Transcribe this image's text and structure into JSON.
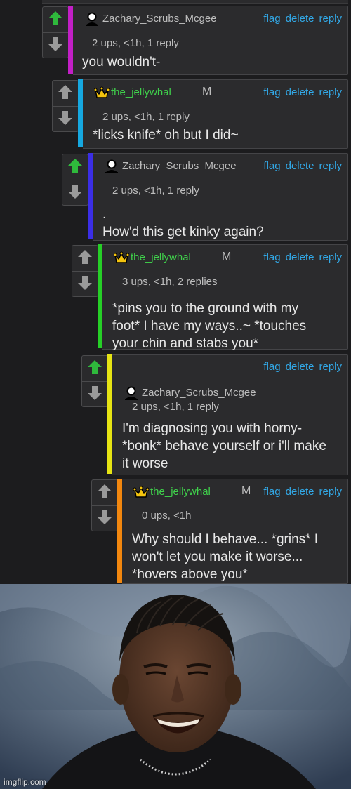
{
  "actions": {
    "flag": "flag",
    "delete": "delete",
    "reply": "reply"
  },
  "comments": [
    {
      "username": "Zachary_Scrubs_Mcgee",
      "mod_badge": "",
      "meta": "2 ups, <1h, 1 reply",
      "body_lines": [
        "you wouldn't-"
      ],
      "bar_color": "#c21fc6",
      "upvoted": true,
      "crown": false
    },
    {
      "username": "the_jellywhal",
      "mod_badge": "M",
      "meta": "2 ups, <1h, 1 reply",
      "body_lines": [
        "*licks knife* oh but I did~"
      ],
      "bar_color": "#16a8e0",
      "upvoted": false,
      "crown": true
    },
    {
      "username": "Zachary_Scrubs_Mcgee",
      "mod_badge": "",
      "meta": "2 ups, <1h, 1 reply",
      "body_lines": [
        ".",
        "How'd this get kinky again?"
      ],
      "bar_color": "#3b2ee6",
      "upvoted": true,
      "crown": false
    },
    {
      "username": "the_jellywhal",
      "mod_badge": "M",
      "meta": "3 ups, <1h, 2 replies",
      "body_lines": [
        "*pins you to the ground with my",
        "foot* I have my ways..~ *touches",
        "your chin and stabs you*"
      ],
      "bar_color": "#26cf27",
      "upvoted": false,
      "crown": true
    },
    {
      "username": "Zachary_Scrubs_Mcgee",
      "mod_badge": "",
      "meta": "2 ups, <1h, 1 reply",
      "body_lines": [
        "I'm diagnosing you with horny-",
        "*bonk* behave yourself or i'll make",
        "it worse"
      ],
      "bar_color": "#e6e414",
      "upvoted": true,
      "crown": false
    },
    {
      "username": "the_jellywhal",
      "mod_badge": "M",
      "meta": "0 ups, <1h",
      "body_lines": [
        "Why should I behave... *grins* I",
        "won't let you make it worse...",
        "*hovers above you*"
      ],
      "bar_color": "#f2870f",
      "upvoted": false,
      "crown": true
    }
  ],
  "meme": {
    "watermark": "imgflip.com"
  },
  "colors": {
    "upvote_active": "#2fb93c",
    "arrow_inactive": "#9a9a9a",
    "crown": "#f4c40f",
    "link": "#32a8e6",
    "username_mod": "#3fd14b"
  }
}
